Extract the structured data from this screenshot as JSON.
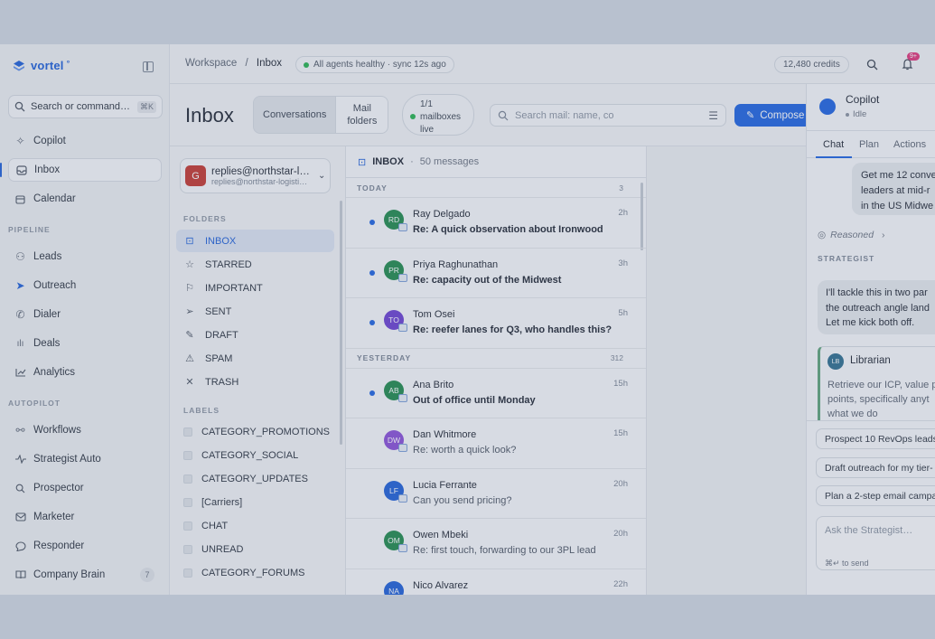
{
  "brand": {
    "name": "vortel",
    "mark": "°"
  },
  "search": {
    "label": "Search or command…",
    "shortcut": "⌘K"
  },
  "nav": {
    "main": [
      {
        "label": "Copilot",
        "icon": "sparkle-icon"
      },
      {
        "label": "Inbox",
        "icon": "inbox-icon"
      },
      {
        "label": "Calendar",
        "icon": "calendar-icon"
      }
    ],
    "pipeline_title": "PIPELINE",
    "pipeline": [
      {
        "label": "Leads",
        "icon": "users-icon"
      },
      {
        "label": "Outreach",
        "icon": "send-icon"
      },
      {
        "label": "Dialer",
        "icon": "phone-icon"
      },
      {
        "label": "Deals",
        "icon": "deals-icon"
      },
      {
        "label": "Analytics",
        "icon": "chart-icon"
      }
    ],
    "autopilot_title": "AUTOPILOT",
    "autopilot": [
      {
        "label": "Workflows",
        "icon": "workflow-icon"
      },
      {
        "label": "Strategist Auto",
        "icon": "pulse-icon"
      },
      {
        "label": "Prospector",
        "icon": "search-icon"
      },
      {
        "label": "Marketer",
        "icon": "mail-icon"
      },
      {
        "label": "Responder",
        "icon": "chat-icon"
      },
      {
        "label": "Company Brain",
        "icon": "book-icon",
        "badge": "7"
      }
    ]
  },
  "topbar": {
    "crumb_root": "Workspace",
    "crumb_sep": "/",
    "crumb_current": "Inbox",
    "health": "All agents healthy · sync 12s ago",
    "credits": "12,480 credits",
    "notif_badge": "9+"
  },
  "inbox": {
    "title": "Inbox",
    "view_on": "Conversations",
    "view_off": "Mail folders",
    "mailboxes": [
      "1/1",
      "mailboxes",
      "live"
    ],
    "search_placeholder": "Search mail: name, co",
    "compose": "Compose"
  },
  "account": {
    "initial": "G",
    "name": "replies@northstar-l…",
    "email": "replies@northstar-logisti…"
  },
  "folders_title": "FOLDERS",
  "folders": [
    {
      "label": "INBOX",
      "icon": "inbox-icon"
    },
    {
      "label": "STARRED",
      "icon": "star-icon"
    },
    {
      "label": "IMPORTANT",
      "icon": "flag-icon"
    },
    {
      "label": "SENT",
      "icon": "send-icon"
    },
    {
      "label": "DRAFT",
      "icon": "pencil-icon"
    },
    {
      "label": "SPAM",
      "icon": "warning-icon"
    },
    {
      "label": "TRASH",
      "icon": "x-icon"
    }
  ],
  "labels_title": "LABELS",
  "labels": [
    "CATEGORY_PROMOTIONS",
    "CATEGORY_SOCIAL",
    "CATEGORY_UPDATES",
    "[Carriers]",
    "CHAT",
    "UNREAD",
    "CATEGORY_FORUMS"
  ],
  "messages": {
    "folder": "INBOX",
    "sep": "·",
    "count": "50 messages",
    "groups": [
      {
        "title": "TODAY",
        "count": "3"
      },
      {
        "title": "YESTERDAY",
        "count": "312"
      }
    ],
    "today": [
      {
        "initials": "RD",
        "name": "Ray Delgado",
        "subject": "Re: A quick observation about Ironwood",
        "time": "2h",
        "color": "#1f8a4c"
      },
      {
        "initials": "PR",
        "name": "Priya Raghunathan",
        "subject": "Re: capacity out of the Midwest",
        "time": "3h",
        "color": "#1f8a4c"
      },
      {
        "initials": "TO",
        "name": "Tom Osei",
        "subject": "Re: reefer lanes for Q3, who handles this?",
        "time": "5h",
        "color": "#6b3fd1"
      }
    ],
    "yesterday": [
      {
        "initials": "AB",
        "name": "Ana Brito",
        "subject": "Out of office until Monday",
        "time": "15h",
        "color": "#1f8a4c",
        "unread": true
      },
      {
        "initials": "DW",
        "name": "Dan Whitmore",
        "subject": "Re: worth a quick look?",
        "time": "15h",
        "color": "#8a4fd8",
        "unread": false
      },
      {
        "initials": "LF",
        "name": "Lucia Ferrante",
        "subject": "Can you send pricing?",
        "time": "20h",
        "color": "#1e5fd8",
        "unread": false
      },
      {
        "initials": "OM",
        "name": "Owen Mbeki",
        "subject": "Re: first touch, forwarding to our 3PL lead",
        "time": "20h",
        "color": "#1f8a4c",
        "unread": false
      },
      {
        "initials": "NA",
        "name": "Nico Alvarez",
        "subject": "",
        "time": "22h",
        "color": "#1e5fd8",
        "unread": false
      }
    ]
  },
  "copilot": {
    "title": "Copilot",
    "status": "Idle",
    "tabs": [
      "Chat",
      "Plan",
      "Actions"
    ],
    "user_msg": [
      "Get me 12 conve",
      "leaders at mid-r",
      "in the US Midwe"
    ],
    "reasoned": "Reasoned",
    "strategist_label": "STRATEGIST",
    "strategist_msg": [
      "I'll tackle this in two par",
      "the outreach angle land",
      "Let me kick both off."
    ],
    "librarian": {
      "initials": "LB",
      "name": "Librarian",
      "text": [
        "Retrieve our ICP, value p",
        "points, specifically anyt",
        "what we do"
      ]
    },
    "suggestions": [
      "Prospect 10 RevOps leads",
      "Draft outreach for my tier-",
      "Plan a 2-step email campa"
    ],
    "ask_placeholder": "Ask the Strategist…",
    "ask_hint": "⌘↵ to send"
  }
}
